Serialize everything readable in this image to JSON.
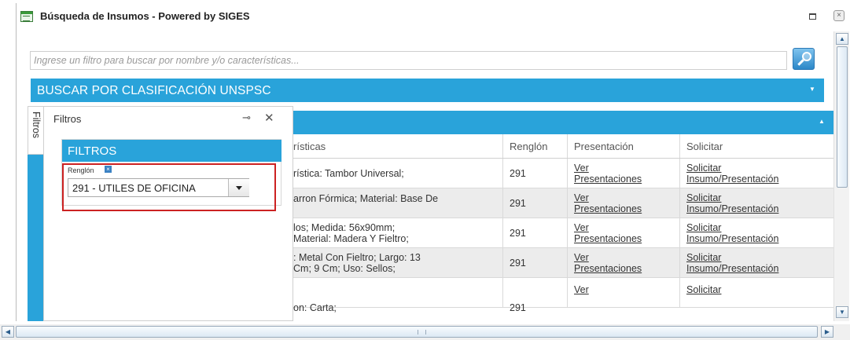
{
  "window": {
    "title": "Búsqueda de Insumos - Powered by SIGES",
    "close_glyph": "×"
  },
  "search": {
    "placeholder": "Ingrese un filtro para buscar por nombre y/o características...",
    "value": ""
  },
  "unspsc": {
    "label": "BUSCAR POR CLASIFICACIÓN UNSPSC"
  },
  "filters_tab": {
    "label": "Filtros"
  },
  "filters_panel": {
    "title": "Filtros",
    "pin_glyph": "⊸",
    "close_glyph": "✕",
    "section_title": "FILTROS",
    "renglon_label": "Renglón",
    "remove_glyph": "×",
    "renglon_value": "291 - UTILES DE OFICINA"
  },
  "table": {
    "columns": [
      "rísticas",
      "Renglón",
      "Presentación",
      "Solicitar"
    ],
    "link_ver": [
      "Ver",
      "Presentaciones"
    ],
    "link_solicitar": [
      "Solicitar",
      "Insumo/Presentación"
    ],
    "rows": [
      {
        "caracteristicas": "rística: Tambor Universal;",
        "renglon": "291"
      },
      {
        "caracteristicas": "arron Fórmica; Material: Base De",
        "renglon": "291"
      },
      {
        "caracteristicas": "los; Medida: 56x90mm; Material: Madera Y Fieltro;",
        "renglon": "291"
      },
      {
        "caracteristicas": ": Metal Con Fieltro; Largo: 13 Cm; 9 Cm; Uso: Sellos;",
        "renglon": "291"
      },
      {
        "caracteristicas": "on: Carta;",
        "renglon": "291"
      }
    ]
  },
  "colors": {
    "accent": "#29a3da",
    "row_shade": "#ececec",
    "highlight": "#cc2222"
  },
  "icons": {
    "window": "window-icon",
    "maximize": "maximize-icon",
    "close": "close-icon",
    "search": "search-icon",
    "pin": "pin-icon",
    "collapse": "chevron-down-icon",
    "dropdown": "dropdown-arrow-icon"
  }
}
